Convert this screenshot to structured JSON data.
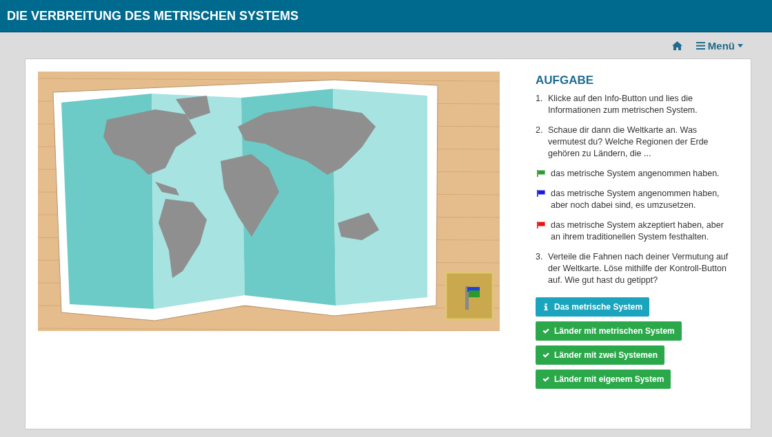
{
  "header": {
    "title": "DIE VERBREITUNG DES METRISCHEN SYSTEMS"
  },
  "nav": {
    "menu_label": "Menü"
  },
  "task": {
    "heading": "AUFGABE",
    "items": [
      {
        "kind": "step",
        "number": "1.",
        "text": "Klicke auf den Info-Button und lies die Informationen zum metrischen System."
      },
      {
        "kind": "step",
        "number": "2.",
        "text": "Schaue dir dann die Weltkarte an. Was vermutest du? Welche Regionen der Erde gehören zu Ländern, die ..."
      },
      {
        "kind": "flag",
        "color": "#2e9c2e",
        "text": "das metrische System angenommen haben."
      },
      {
        "kind": "flag",
        "color": "#1a1adf",
        "text": "das metrische System angenommen haben, aber noch dabei sind, es umzusetzen."
      },
      {
        "kind": "flag",
        "color": "#ee1111",
        "text": "das metrische System akzeptiert haben, aber an ihrem traditionellen System festhalten."
      },
      {
        "kind": "step",
        "number": "3.",
        "text": "Verteile die Fahnen nach deiner Vermutung auf der Weltkarte. Löse mithilfe der Kontroll-Button auf. Wie gut hast du getippt?"
      }
    ],
    "buttons": [
      {
        "kind": "info",
        "label": "Das metrische System"
      },
      {
        "kind": "check",
        "label": "Länder mit metrischen System"
      },
      {
        "kind": "check",
        "label": "Länder mit zwei Systemen"
      },
      {
        "kind": "check",
        "label": "Länder mit eigenem System"
      }
    ]
  }
}
